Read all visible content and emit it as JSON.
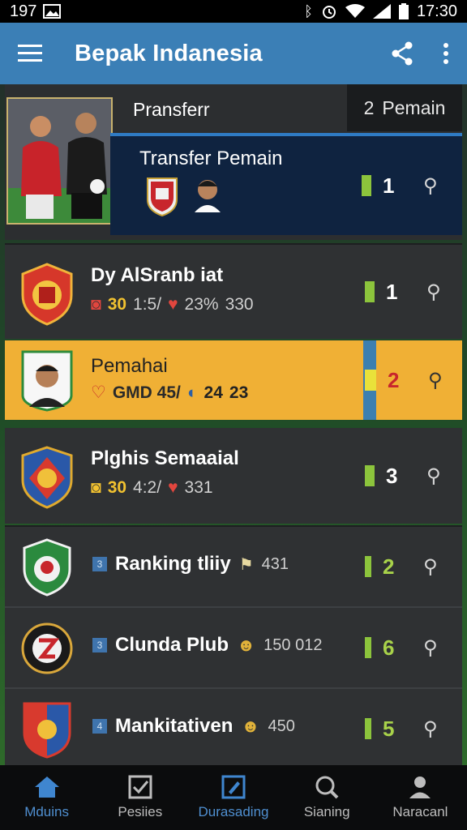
{
  "status": {
    "left_text": "197",
    "time": "17:30"
  },
  "app": {
    "title": "Bepak Indanesia",
    "share_icon": "share-icon",
    "more_icon": "more-vert-icon"
  },
  "featured": {
    "tag": "Pransferr",
    "count_number": "2",
    "count_label": "Pemain",
    "card_title": "Transfer Pemain",
    "rank": "1"
  },
  "rows": [
    {
      "name": "Dy AlSranb iat",
      "stat_main": "30",
      "stat_a": "1:5/",
      "stat_b": "23%",
      "stat_c": "330",
      "rank": "1"
    },
    {
      "name": "Pemahai",
      "stat_main": "GMD 45/",
      "stat_a": "24",
      "stat_b": "23",
      "rank": "2"
    },
    {
      "name": "Plghis Semaaial",
      "stat_main": "30",
      "stat_a": "4:2/",
      "stat_b": "331",
      "rank": "3"
    }
  ],
  "compact_rows": [
    {
      "chip": "3",
      "name": "Ranking tliiy",
      "meta": "431",
      "rank": "2"
    },
    {
      "chip": "3",
      "name": "Clunda Plub",
      "meta": "150 012",
      "rank": "6"
    },
    {
      "chip": "4",
      "name": "Mankitativen",
      "meta": "450",
      "rank": "5"
    }
  ],
  "nav": [
    {
      "label": "Mduins",
      "icon": "home-icon"
    },
    {
      "label": "Pesiies",
      "icon": "checkbox-icon"
    },
    {
      "label": "Durasading",
      "icon": "edit-icon"
    },
    {
      "label": "Sianing",
      "icon": "search-icon"
    },
    {
      "label": "Naracanl",
      "icon": "person-icon"
    }
  ],
  "colors": {
    "app_bar": "#3b7fb6",
    "highlight": "#f0b035",
    "rank_green": "#8cc43c",
    "nav_active": "#4f8fd0"
  }
}
